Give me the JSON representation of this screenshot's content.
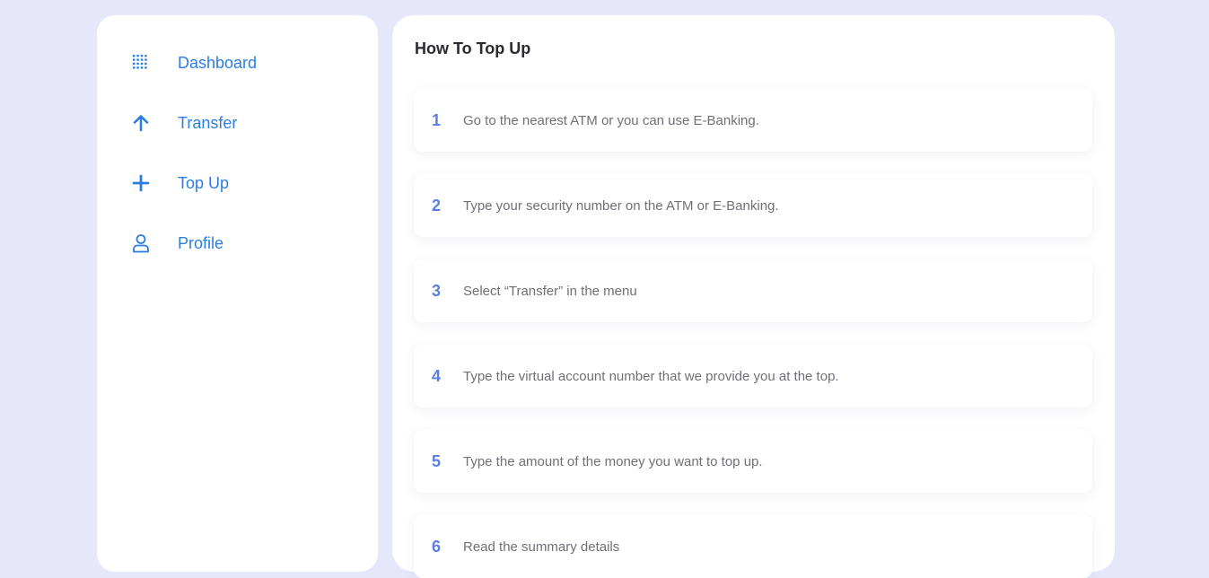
{
  "colors": {
    "background": "#e6e7fb",
    "accent": "#2c7de0",
    "step_number": "#5b7fe0",
    "text": "#6f6f78"
  },
  "sidebar": {
    "items": [
      {
        "label": "Dashboard",
        "icon": "grid-icon"
      },
      {
        "label": "Transfer",
        "icon": "arrow-up-icon"
      },
      {
        "label": "Top Up",
        "icon": "plus-icon"
      },
      {
        "label": "Profile",
        "icon": "user-icon"
      }
    ]
  },
  "main": {
    "title": "How To Top Up",
    "steps": [
      {
        "number": "1",
        "text": "Go to the nearest ATM or you can use E-Banking."
      },
      {
        "number": "2",
        "text": "Type your security number on the ATM or E-Banking."
      },
      {
        "number": "3",
        "text": "Select “Transfer” in the menu"
      },
      {
        "number": "4",
        "text": "Type the virtual account number that we provide you at the top."
      },
      {
        "number": "5",
        "text": "Type the amount of the money you want to top up."
      },
      {
        "number": "6",
        "text": "Read the summary details"
      }
    ]
  }
}
